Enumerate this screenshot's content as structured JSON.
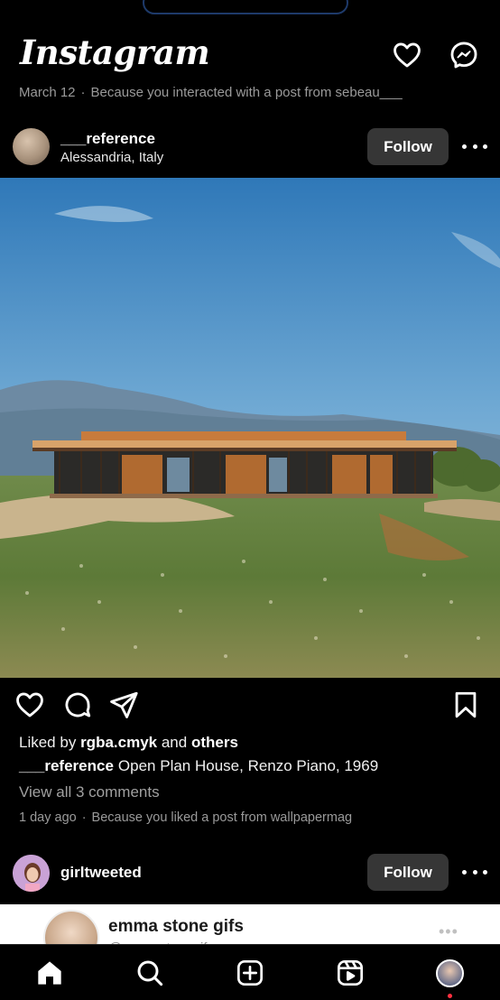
{
  "app": {
    "logo_text": "Instagram"
  },
  "topbar": {
    "icons": [
      "heart-icon",
      "messenger-icon"
    ]
  },
  "suggestion": {
    "date": "March 12",
    "reason": "Because you interacted with a post from sebeau___"
  },
  "post1": {
    "username": "___reference",
    "location": "Alessandria, Italy",
    "follow_label": "Follow",
    "image_description": "Open plan house photograph",
    "likes": {
      "prefix": "Liked by",
      "user": "rgba.cmyk",
      "connector": "and",
      "others": "others"
    },
    "caption": {
      "username": "___reference",
      "text": "Open Plan House, Renzo Piano, 1969"
    },
    "comments_link": "View all 3 comments",
    "meta": {
      "time": "1 day ago",
      "reason": "Because you liked a post from wallpapermag"
    }
  },
  "post2": {
    "username": "girltweeted",
    "follow_label": "Follow",
    "card": {
      "name": "emma stone gifs",
      "handle": "@emmastonegifs"
    }
  },
  "bottom_nav": {
    "items": [
      "home-icon",
      "search-icon",
      "create-icon",
      "reels-icon",
      "profile-avatar"
    ]
  },
  "colors": {
    "background": "#000000",
    "button_bg": "#363636",
    "secondary_text": "#9a9a9a",
    "notification_dot": "#ff3040"
  }
}
